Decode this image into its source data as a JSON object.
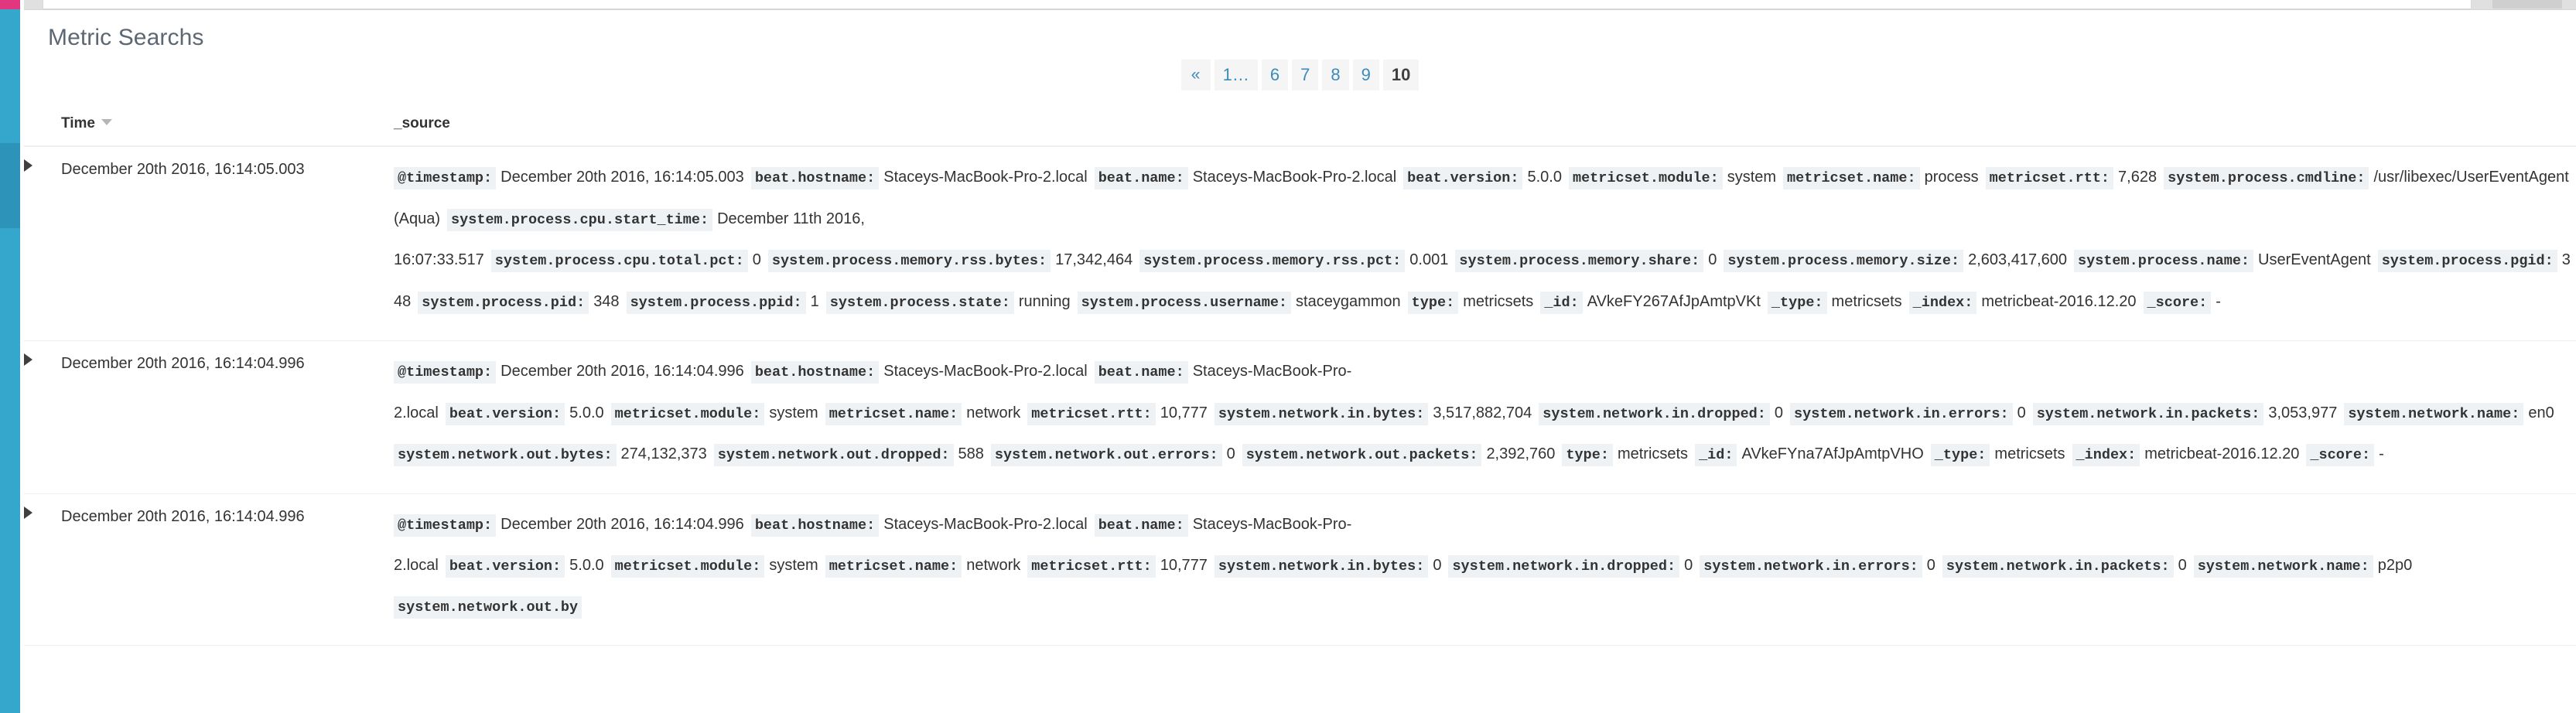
{
  "window": {
    "title": "Metric Searchs"
  },
  "header": {
    "title": "Metric Searchs"
  },
  "pagination": {
    "prev_label": "«",
    "items": [
      {
        "label": "1…",
        "active": false
      },
      {
        "label": "6",
        "active": false
      },
      {
        "label": "7",
        "active": false
      },
      {
        "label": "8",
        "active": false
      },
      {
        "label": "9",
        "active": false
      },
      {
        "label": "10",
        "active": true
      }
    ]
  },
  "table": {
    "columns": {
      "time": "Time",
      "source": "_source"
    },
    "sort_direction": "desc",
    "rows": [
      {
        "time": "December 20th 2016, 16:14:05.003",
        "truncated": true,
        "fields": [
          {
            "name": "@timestamp:",
            "value": "December 20th 2016, 16:14:05.003"
          },
          {
            "name": "beat.hostname:",
            "value": "Staceys-MacBook-Pro-2.local"
          },
          {
            "name": "beat.name:",
            "value": "Staceys-MacBook-Pro-2.local"
          },
          {
            "name": "beat.version:",
            "value": "5.0.0"
          },
          {
            "name": "metricset.module:",
            "value": "system"
          },
          {
            "name": "metricset.name:",
            "value": "process"
          },
          {
            "name": "metricset.rtt:",
            "value": "7,628"
          },
          {
            "name": "system.process.cmdline:",
            "value": "/usr/libexec/UserEventAgent (Aqua)"
          },
          {
            "name": "system.process.cpu.start_time:",
            "value": "December 11th 2016, 16:07:33.517"
          },
          {
            "name": "system.process.cpu.total.pct:",
            "value": "0"
          },
          {
            "name": "system.process.memory.rss.bytes:",
            "value": "17,342,464"
          },
          {
            "name": "system.process.memory.rss.pct:",
            "value": "0.001"
          },
          {
            "name": "system.process.memory.share:",
            "value": "0"
          },
          {
            "name": "system.process.memory.size:",
            "value": "2,603,417,600"
          },
          {
            "name": "system.process.name:",
            "value": "UserEventAgent"
          },
          {
            "name": "system.process.pgid:",
            "value": "348"
          },
          {
            "name": "system.process.pid:",
            "value": "348"
          },
          {
            "name": "system.process.ppid:",
            "value": "1"
          },
          {
            "name": "system.process.state:",
            "value": "running"
          },
          {
            "name": "system.process.username:",
            "value": "staceygammon"
          },
          {
            "name": "type:",
            "value": "metricsets"
          },
          {
            "name": "_id:",
            "value": "AVkeFY267AfJpAmtpVKt"
          },
          {
            "name": "_type:",
            "value": "metricsets"
          },
          {
            "name": "_index:",
            "value": "metricbeat-2016.12.20"
          },
          {
            "name": "_score:",
            "value": "-"
          }
        ]
      },
      {
        "time": "December 20th 2016, 16:14:04.996",
        "truncated": false,
        "fields": [
          {
            "name": "@timestamp:",
            "value": "December 20th 2016, 16:14:04.996"
          },
          {
            "name": "beat.hostname:",
            "value": "Staceys-MacBook-Pro-2.local"
          },
          {
            "name": "beat.name:",
            "value": "Staceys-MacBook-Pro-2.local"
          },
          {
            "name": "beat.version:",
            "value": "5.0.0"
          },
          {
            "name": "metricset.module:",
            "value": "system"
          },
          {
            "name": "metricset.name:",
            "value": "network"
          },
          {
            "name": "metricset.rtt:",
            "value": "10,777"
          },
          {
            "name": "system.network.in.bytes:",
            "value": "3,517,882,704"
          },
          {
            "name": "system.network.in.dropped:",
            "value": "0"
          },
          {
            "name": "system.network.in.errors:",
            "value": "0"
          },
          {
            "name": "system.network.in.packets:",
            "value": "3,053,977"
          },
          {
            "name": "system.network.name:",
            "value": "en0"
          },
          {
            "name": "system.network.out.bytes:",
            "value": "274,132,373"
          },
          {
            "name": "system.network.out.dropped:",
            "value": "588"
          },
          {
            "name": "system.network.out.errors:",
            "value": "0"
          },
          {
            "name": "system.network.out.packets:",
            "value": "2,392,760"
          },
          {
            "name": "type:",
            "value": "metricsets"
          },
          {
            "name": "_id:",
            "value": "AVkeFYna7AfJpAmtpVHO"
          },
          {
            "name": "_type:",
            "value": "metricsets"
          },
          {
            "name": "_index:",
            "value": "metricbeat-2016.12.20"
          },
          {
            "name": "_score:",
            "value": "-"
          }
        ]
      },
      {
        "time": "December 20th 2016, 16:14:04.996",
        "truncated": true,
        "fields": [
          {
            "name": "@timestamp:",
            "value": "December 20th 2016, 16:14:04.996"
          },
          {
            "name": "beat.hostname:",
            "value": "Staceys-MacBook-Pro-2.local"
          },
          {
            "name": "beat.name:",
            "value": "Staceys-MacBook-Pro-2.local"
          },
          {
            "name": "beat.version:",
            "value": "5.0.0"
          },
          {
            "name": "metricset.module:",
            "value": "system"
          },
          {
            "name": "metricset.name:",
            "value": "network"
          },
          {
            "name": "metricset.rtt:",
            "value": "10,777"
          },
          {
            "name": "system.network.in.bytes:",
            "value": "0"
          },
          {
            "name": "system.network.in.dropped:",
            "value": "0"
          },
          {
            "name": "system.network.in.errors:",
            "value": "0"
          },
          {
            "name": "system.network.in.packets:",
            "value": "0"
          },
          {
            "name": "system.network.name:",
            "value": "p2p0"
          },
          {
            "name": "system.network.out.by",
            "value": ""
          }
        ]
      }
    ]
  },
  "colors": {
    "rail": "#35a7cd",
    "rail_active": "#2e93b8",
    "rail_accent": "#e2377f",
    "link": "#3b8bba",
    "field_bg": "#eef2f4",
    "text": "#333333",
    "title": "#5c6773"
  }
}
